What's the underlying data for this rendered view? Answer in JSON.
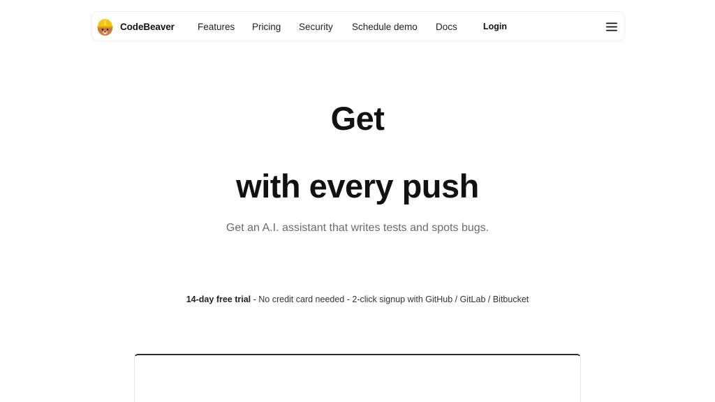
{
  "brand": {
    "name": "CodeBeaver",
    "logo_icon": "beaver-logo-icon"
  },
  "nav": {
    "links": [
      {
        "label": "Features"
      },
      {
        "label": "Pricing"
      },
      {
        "label": "Security"
      },
      {
        "label": "Schedule demo"
      },
      {
        "label": "Docs"
      }
    ],
    "login_label": "Login",
    "menu_icon": "hamburger-menu-icon"
  },
  "hero": {
    "line1": "Get",
    "line2": "with every push",
    "subtitle": "Get an A.I. assistant that writes tests and spots bugs."
  },
  "trial": {
    "strong": "14-day free trial",
    "rest": " - No credit card needed - 2-click signup with GitHub / GitLab / Bitbucket"
  },
  "colors": {
    "text_primary": "#111111",
    "text_muted": "#6b6b6b",
    "logo_helmet": "#f5c518",
    "logo_face": "#c77a4a"
  }
}
